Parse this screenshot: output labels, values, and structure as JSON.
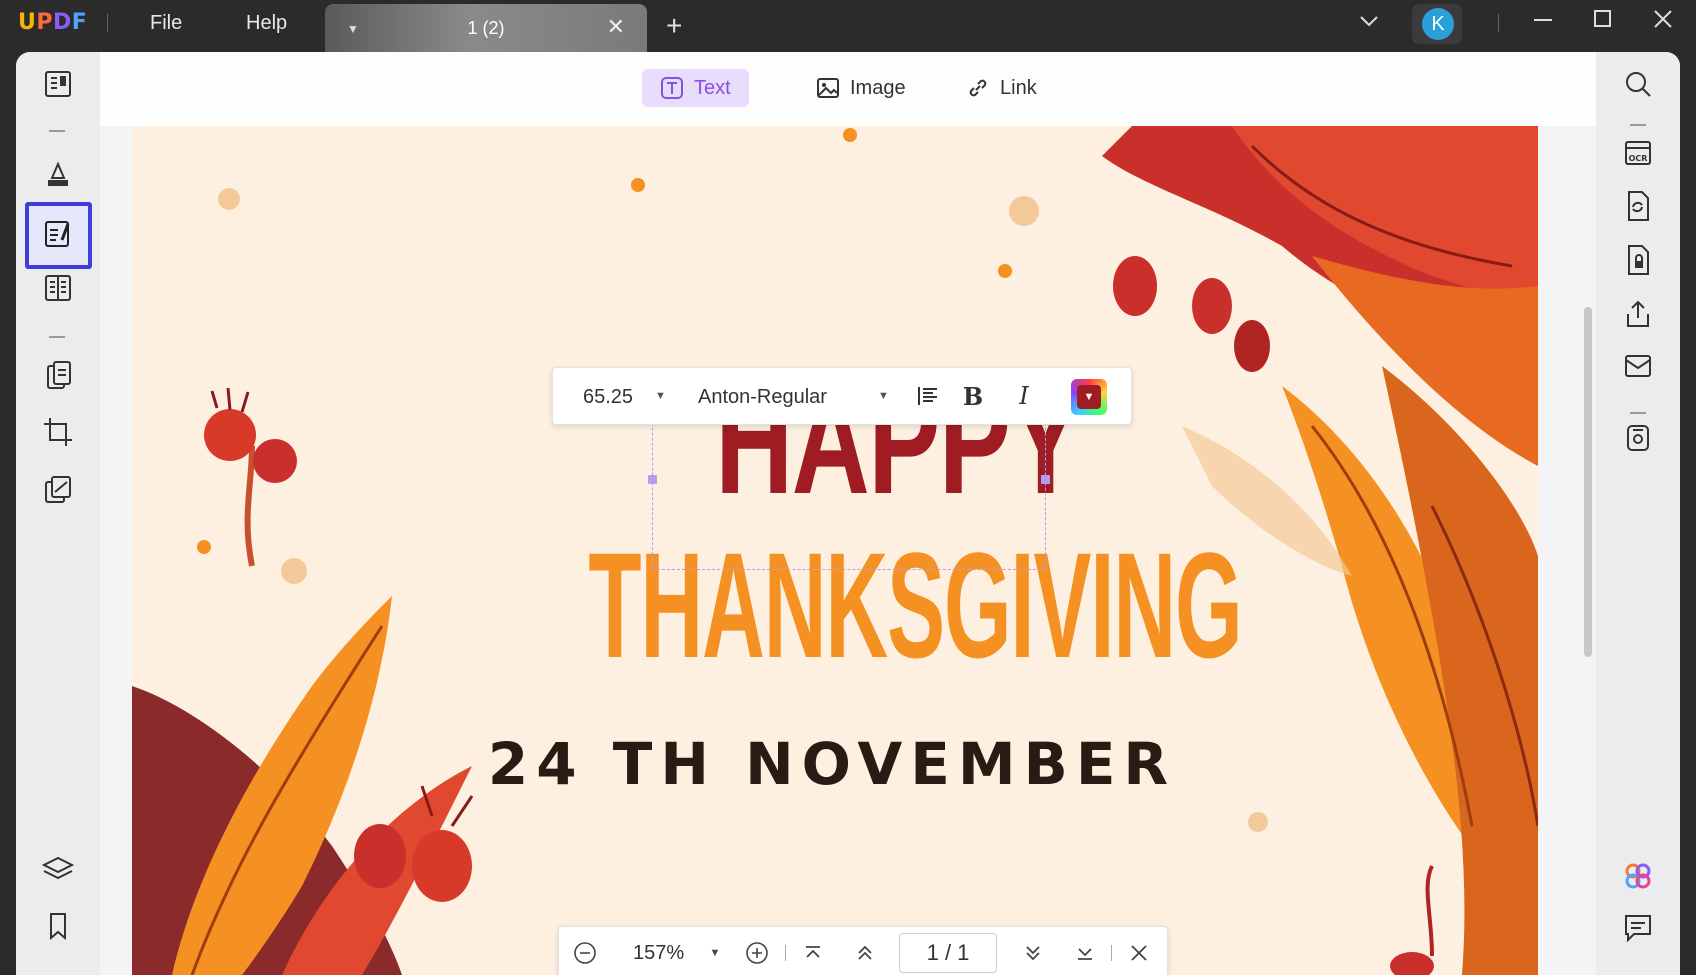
{
  "app": {
    "logo": "UPDF",
    "menu": [
      "File",
      "Help"
    ],
    "tab_title": "1 (2)",
    "user_initial": "K"
  },
  "edit_toolbar": {
    "text": "Text",
    "image": "Image",
    "link": "Link"
  },
  "format_toolbar": {
    "font_size": "65.25",
    "font_name": "Anton-Regular",
    "text_color": "#9e1c22"
  },
  "page_content": {
    "line1": "HAPPY",
    "line2": "THANKSGIVING",
    "line3": "24 TH NOVEMBER"
  },
  "zoom_bar": {
    "zoom": "157%",
    "page_indicator": "1 / 1"
  },
  "colors": {
    "accent": "#8a4fe0",
    "selection": "#3d3fd6",
    "title_red": "#9e1c22",
    "title_orange": "#f49122"
  },
  "left_sidebar_icons": [
    "reader-icon",
    "comment-icon",
    "edit-pdf-icon",
    "page-view-icon",
    "organize-pages-icon",
    "crop-icon",
    "redact-icon",
    "layers-icon",
    "bookmark-icon"
  ],
  "right_sidebar_icons": [
    "search-icon",
    "ocr-icon",
    "convert-icon",
    "protect-icon",
    "share-icon",
    "email-icon",
    "save-icon",
    "ai-assistant-icon",
    "chat-icon"
  ]
}
